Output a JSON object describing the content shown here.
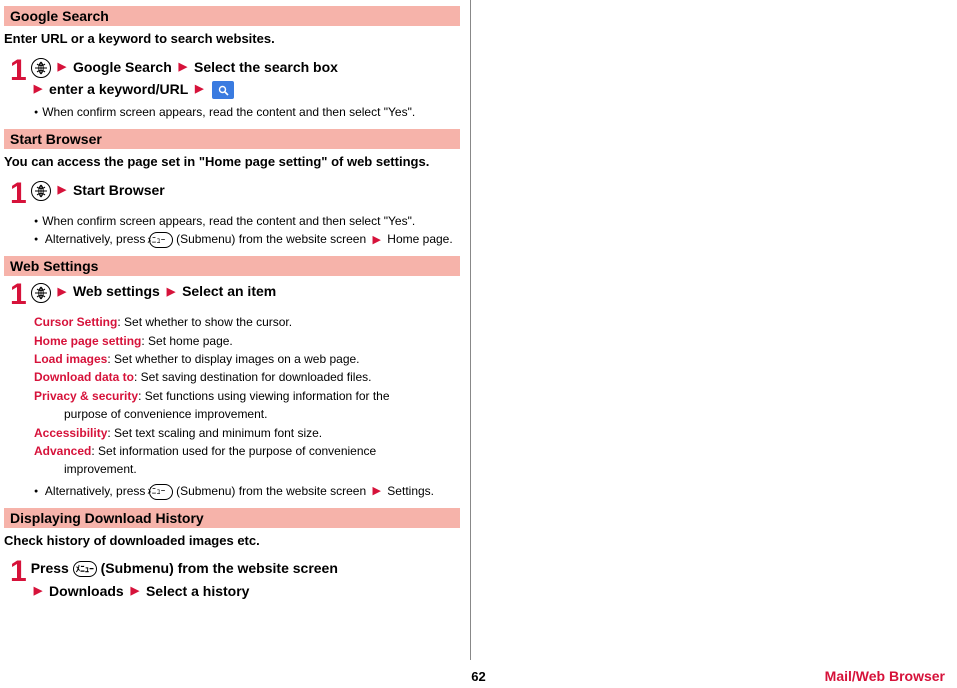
{
  "sections": {
    "google": {
      "title": "Google Search",
      "lead": "Enter URL or a keyword to search websites.",
      "step_a": "Google Search",
      "step_b": "Select the search box",
      "step_c": "enter a keyword/URL",
      "note1": "When confirm screen appears, read the content and then select \"Yes\"."
    },
    "browser": {
      "title": "Start Browser",
      "lead": "You can access the page set in \"Home page setting\" of web settings.",
      "step_a": "Start Browser",
      "note1": "When confirm screen appears, read the content and then select \"Yes\".",
      "note2a": "Alternatively, press ",
      "note2b": " (Submenu) from the website screen ",
      "note2c": " Home page."
    },
    "web": {
      "title": "Web Settings",
      "step_a": "Web settings",
      "step_b": "Select an item",
      "items": [
        {
          "name": "Cursor Setting",
          "desc": ": Set whether to show the cursor."
        },
        {
          "name": "Home page setting",
          "desc": ": Set home page."
        },
        {
          "name": "Load images",
          "desc": ": Set whether to display images on a web page."
        },
        {
          "name": "Download data to",
          "desc": ": Set saving destination for downloaded files."
        },
        {
          "name": "Privacy & security",
          "desc": ": Set functions using viewing information for the",
          "cont": "purpose of convenience improvement."
        },
        {
          "name": "Accessibility",
          "desc": ": Set text scaling and minimum font size."
        },
        {
          "name": "Advanced",
          "desc": ": Set information used for the purpose of convenience",
          "cont": "improvement."
        }
      ],
      "note2a": "Alternatively, press ",
      "note2b": " (Submenu) from the website screen ",
      "note2c": " Settings."
    },
    "download": {
      "title": "Displaying Download History",
      "lead": "Check history of downloaded images etc.",
      "step_a": "Press ",
      "step_a2": " (Submenu) from the website screen",
      "step_b": "Downloads",
      "step_c": "Select a history"
    }
  },
  "footer": {
    "page": "62",
    "section": "Mail/Web Browser"
  }
}
